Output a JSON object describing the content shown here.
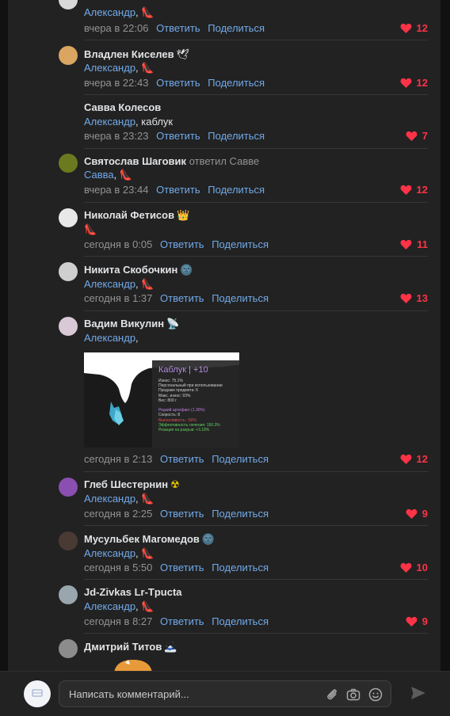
{
  "colors": {
    "background": "#111111",
    "panel": "#222222",
    "link": "#71aaeb",
    "like": "#ff3347",
    "secondary": "#939393"
  },
  "actions": {
    "reply": "Ответить",
    "share": "Поделиться"
  },
  "comments": [
    {
      "name": "",
      "reply_note": "",
      "mention": "Александр",
      "text": "",
      "emoji_text": "👠",
      "time": "вчера в 22:06",
      "likes": "12",
      "badge": ""
    },
    {
      "name": "Владлен Киселев",
      "reply_note": "",
      "mention": "Александр",
      "text": "",
      "emoji_text": "👠",
      "time": "вчера в 22:43",
      "likes": "12",
      "badge": "🕊"
    },
    {
      "name": "Савва Колесов",
      "reply_note": "",
      "mention": "Александр",
      "text": "каблук",
      "emoji_text": "",
      "time": "вчера в 23:23",
      "likes": "7",
      "badge": ""
    },
    {
      "name": "Святослав Шаговик",
      "reply_note": "ответил Савве",
      "mention": "Савва",
      "text": "",
      "emoji_text": "👠",
      "time": "вчера в 23:44",
      "likes": "12",
      "badge": ""
    },
    {
      "name": "Николай Фетисов",
      "reply_note": "",
      "mention": "",
      "text": "",
      "emoji_text": "👠",
      "time": "сегодня в 0:05",
      "likes": "11",
      "badge": "👑"
    },
    {
      "name": "Никита Скобочкин",
      "reply_note": "",
      "mention": "Александр",
      "text": "",
      "emoji_text": "👠",
      "time": "сегодня в 1:37",
      "likes": "13",
      "badge": "🌚"
    },
    {
      "name": "Вадим Викулин",
      "reply_note": "",
      "mention": "Александр",
      "text": "",
      "emoji_text": "",
      "time": "сегодня в 2:13",
      "likes": "12",
      "badge": "📡"
    },
    {
      "name": "Глеб Шестернин",
      "reply_note": "",
      "mention": "Александр",
      "text": "",
      "emoji_text": "👠",
      "time": "сегодня в 2:25",
      "likes": "9",
      "badge": "☢"
    },
    {
      "name": "Мусульбек Магомедов",
      "reply_note": "",
      "mention": "Александр",
      "text": "",
      "emoji_text": "👠",
      "time": "сегодня в 5:50",
      "likes": "10",
      "badge": "🌚"
    },
    {
      "name": "Jd-Zivkas Lr-Tpucta",
      "reply_note": "",
      "mention": "Александр",
      "text": "",
      "emoji_text": "👠",
      "time": "сегодня в 8:27",
      "likes": "9",
      "badge": ""
    },
    {
      "name": "Дмитрий Титов",
      "reply_note": "",
      "mention": "",
      "text": "",
      "emoji_text": "",
      "time": "",
      "likes": "",
      "badge": "🗻"
    }
  ],
  "attachment": {
    "title": "Каблук | +10",
    "stats": [
      "Износ: 75.1%",
      "Персональный при использовании",
      "Продаже предмета: 6",
      "Макс. износ: 93%",
      "Вес: 800 г",
      "",
      "Редкий артефакт (1.30%)",
      "Скорость: 8",
      "Выносливость: -50%",
      "Эффективность лечения: 150.3%",
      "Реакция на разрыв: +3.18%"
    ]
  },
  "comment_input": {
    "placeholder": "Написать комментарий..."
  }
}
